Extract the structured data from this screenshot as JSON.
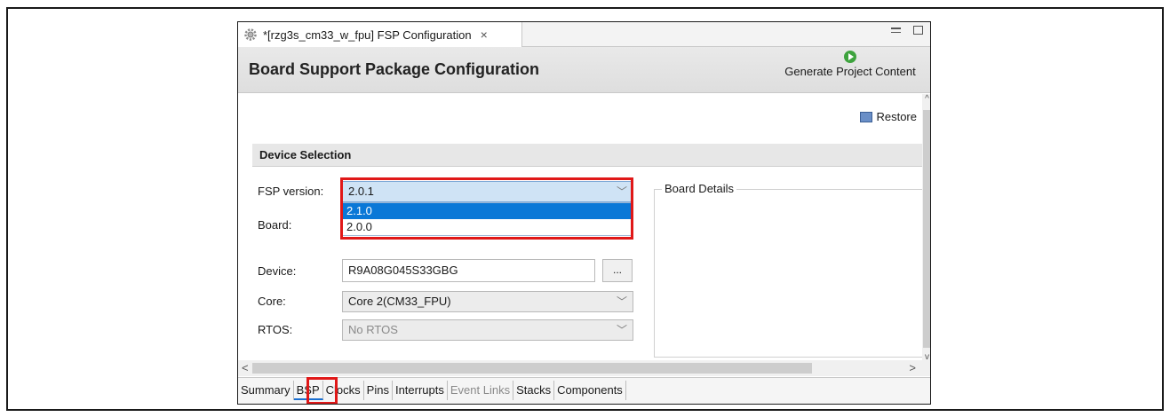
{
  "tab": {
    "title": "*[rzg3s_cm33_w_fpu] FSP Configuration",
    "close": "×",
    "icon": "gear-icon"
  },
  "header": {
    "title": "Board Support Package Configuration",
    "generate_label": "Generate Project Content"
  },
  "toolbar": {
    "restore_label": "Restore"
  },
  "device_selection": {
    "title": "Device Selection",
    "fsp_version_label": "FSP version:",
    "fsp_version_value": "2.0.1",
    "fsp_version_options": [
      "2.1.0",
      "2.0.0"
    ],
    "board_label": "Board:",
    "device_label": "Device:",
    "device_value": "R9A08G045S33GBG",
    "browse_label": "...",
    "core_label": "Core:",
    "core_value": "Core 2(CM33_FPU)",
    "rtos_label": "RTOS:",
    "rtos_value": "No RTOS"
  },
  "board_details": {
    "title": "Board Details"
  },
  "bottom_tabs": [
    "Summary",
    "BSP",
    "Clocks",
    "Pins",
    "Interrupts",
    "Event Links",
    "Stacks",
    "Components"
  ],
  "colors": {
    "highlight": "#e01818",
    "selection": "#0a78d7",
    "generate_icon": "#3ea33e"
  }
}
